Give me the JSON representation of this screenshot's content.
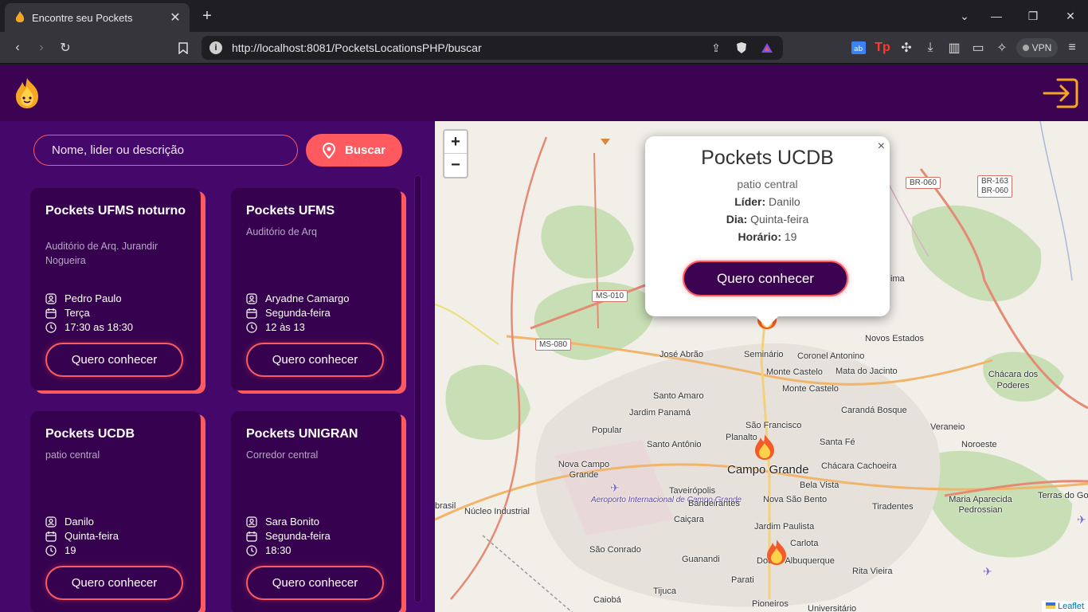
{
  "browser": {
    "tab_title": "Encontre seu Pockets",
    "url": "http://localhost:8081/PocketsLocationsPHP/buscar",
    "vpn_label": "VPN"
  },
  "search": {
    "placeholder": "Nome, lider ou descrição",
    "button_label": "Buscar"
  },
  "cards": [
    {
      "title": "Pockets UFMS noturno",
      "description": "Auditório de Arq. Jurandir Nogueira",
      "leader": "Pedro Paulo",
      "day": "Terça",
      "time": "17:30 as 18:30",
      "button": "Quero conhecer"
    },
    {
      "title": "Pockets UFMS",
      "description": "Auditório de Arq",
      "leader": "Aryadne Camargo",
      "day": "Segunda-feira",
      "time": "12 às 13",
      "button": "Quero conhecer"
    },
    {
      "title": "Pockets UCDB",
      "description": "patio central",
      "leader": "Danilo",
      "day": "Quinta-feira",
      "time": "19",
      "button": "Quero conhecer"
    },
    {
      "title": "Pockets UNIGRAN",
      "description": "Corredor central",
      "leader": "Sara Bonito",
      "day": "Segunda-feira",
      "time": "18:30",
      "button": "Quero conhecer"
    }
  ],
  "popup": {
    "title": "Pockets UCDB",
    "description": "patio central",
    "leader_label": "Líder:",
    "leader": "Danilo",
    "day_label": "Dia:",
    "day": "Quinta-feira",
    "time_label": "Horário:",
    "time": "19",
    "button": "Quero conhecer",
    "close": "×"
  },
  "map": {
    "zoom_in": "+",
    "zoom_out": "−",
    "attribution": "Leaflet",
    "labels": {
      "campo_grande": "Campo Grande",
      "jose_abrao": "José Abrão",
      "seminario": "Seminário",
      "coronel_antonino": "Coronel Antonino",
      "novos_estados": "Novos Estados",
      "monte_castelo": "Monte Castelo",
      "mata_do_jacinto": "Mata do Jacinto",
      "monte_castelo_2": "Monte Castelo",
      "chacara_dos_poderes": "Chácara dos Poderes",
      "santo_amaro": "Santo Amaro",
      "jardim_panama": "Jardim Panamá",
      "caranda_bosque": "Carandá Bosque",
      "veraneio": "Veraneio",
      "popular": "Popular",
      "santo_antonio": "Santo Antônio",
      "sao_francisco": "São Francisco",
      "planalto": "Planalto",
      "santa_fe": "Santa Fé",
      "noroeste": "Noroeste",
      "nova_campo_grande": "Nova Campo Grande",
      "chacara_cachoeira": "Chácara Cachoeira",
      "bela_vista": "Bela Vista",
      "aeroporto": "Aeroporto Internacional de Campo Grande",
      "taveiropolis": "Taveirópolis",
      "nova_sao_bento": "Nova São Bento",
      "tiradentes": "Tiradentes",
      "maria_aparecida": "Maria Aparecida Pedrossian",
      "terras_do_golf": "Terras do Go",
      "brasil": "brasil",
      "nucleo_industrial": "Núcleo Industrial",
      "bandeirantes": "Bandeirantes",
      "caicara": "Caiçara",
      "jardim_paulista": "Jardim Paulista",
      "carlota": "Carlota",
      "sao_conrado": "São Conrado",
      "guanandi": "Guanandi",
      "doutor_albuquerque": "Doutor Albuquerque",
      "rita_vieira": "Rita Vieira",
      "parati": "Parati",
      "tijuca": "Tijuca",
      "caioba": "Caiobá",
      "pioneiros": "Pioneiros",
      "universitario": "Universitário",
      "lima": "ima"
    },
    "roads": {
      "ms010": "MS-010",
      "ms080": "MS-080",
      "br060": "BR-060",
      "br163": "BR-163",
      "br060b": "BR-060"
    }
  }
}
